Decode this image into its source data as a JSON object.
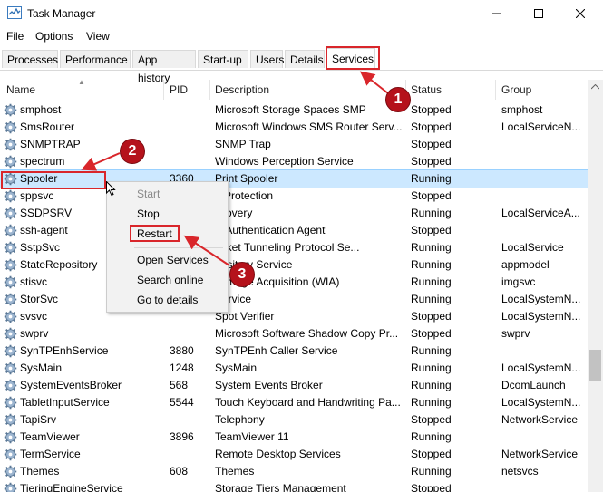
{
  "window": {
    "title": "Task Manager",
    "icon": "task-manager-icon",
    "controls": [
      "minimize-icon",
      "maximize-icon",
      "close-icon"
    ]
  },
  "menu": [
    "File",
    "Options",
    "View"
  ],
  "tabs": [
    "Processes",
    "Performance",
    "App history",
    "Start-up",
    "Users",
    "Details",
    "Services"
  ],
  "active_tab": "Services",
  "columns": {
    "name": "Name",
    "pid": "PID",
    "description": "Description",
    "status": "Status",
    "group": "Group"
  },
  "rows": [
    {
      "name": "smphost",
      "pid": "",
      "description": "Microsoft Storage Spaces SMP",
      "status": "Stopped",
      "group": "smphost"
    },
    {
      "name": "SmsRouter",
      "pid": "",
      "description": "Microsoft Windows SMS Router Serv...",
      "status": "Stopped",
      "group": "LocalServiceN..."
    },
    {
      "name": "SNMPTRAP",
      "pid": "",
      "description": "SNMP Trap",
      "status": "Stopped",
      "group": ""
    },
    {
      "name": "spectrum",
      "pid": "",
      "description": "Windows Perception Service",
      "status": "Stopped",
      "group": ""
    },
    {
      "name": "Spooler",
      "pid": "3360",
      "description": "Print Spooler",
      "status": "Running",
      "group": ""
    },
    {
      "name": "sppsvc",
      "pid": "",
      "description": "e Protection",
      "status": "Stopped",
      "group": ""
    },
    {
      "name": "SSDPSRV",
      "pid": "",
      "description": "scovery",
      "status": "Running",
      "group": "LocalServiceA..."
    },
    {
      "name": "ssh-agent",
      "pid": "",
      "description": "H Authentication Agent",
      "status": "Stopped",
      "group": ""
    },
    {
      "name": "SstpSvc",
      "pid": "",
      "description": "ocket Tunneling Protocol Se...",
      "status": "Running",
      "group": "LocalService"
    },
    {
      "name": "StateRepository",
      "pid": "",
      "description": "pository Service",
      "status": "Running",
      "group": "appmodel"
    },
    {
      "name": "stisvc",
      "pid": "",
      "description": "s Image Acquisition (WIA)",
      "status": "Running",
      "group": "imgsvc"
    },
    {
      "name": "StorSvc",
      "pid": "",
      "description": "Service",
      "status": "Running",
      "group": "LocalSystemN..."
    },
    {
      "name": "svsvc",
      "pid": "",
      "description": "Spot Verifier",
      "status": "Stopped",
      "group": "LocalSystemN..."
    },
    {
      "name": "swprv",
      "pid": "",
      "description": "Microsoft Software Shadow Copy Pr...",
      "status": "Stopped",
      "group": "swprv"
    },
    {
      "name": "SynTPEnhService",
      "pid": "3880",
      "description": "SynTPEnh Caller Service",
      "status": "Running",
      "group": ""
    },
    {
      "name": "SysMain",
      "pid": "1248",
      "description": "SysMain",
      "status": "Running",
      "group": "LocalSystemN..."
    },
    {
      "name": "SystemEventsBroker",
      "pid": "568",
      "description": "System Events Broker",
      "status": "Running",
      "group": "DcomLaunch"
    },
    {
      "name": "TabletInputService",
      "pid": "5544",
      "description": "Touch Keyboard and Handwriting Pa...",
      "status": "Running",
      "group": "LocalSystemN..."
    },
    {
      "name": "TapiSrv",
      "pid": "",
      "description": "Telephony",
      "status": "Stopped",
      "group": "NetworkService"
    },
    {
      "name": "TeamViewer",
      "pid": "3896",
      "description": "TeamViewer 11",
      "status": "Running",
      "group": ""
    },
    {
      "name": "TermService",
      "pid": "",
      "description": "Remote Desktop Services",
      "status": "Stopped",
      "group": "NetworkService"
    },
    {
      "name": "Themes",
      "pid": "608",
      "description": "Themes",
      "status": "Running",
      "group": "netsvcs"
    },
    {
      "name": "TieringEngineService",
      "pid": "",
      "description": "Storage Tiers Management",
      "status": "Stopped",
      "group": ""
    }
  ],
  "context_menu": {
    "start": "Start",
    "stop": "Stop",
    "restart": "Restart",
    "open_services": "Open Services",
    "search_online": "Search online",
    "go_to_details": "Go to details"
  },
  "callouts": [
    "1",
    "2",
    "3"
  ],
  "colors": {
    "selection": "#cce8ff",
    "annotation_red": "#d9262b",
    "callout_fill": "#b5121b"
  }
}
